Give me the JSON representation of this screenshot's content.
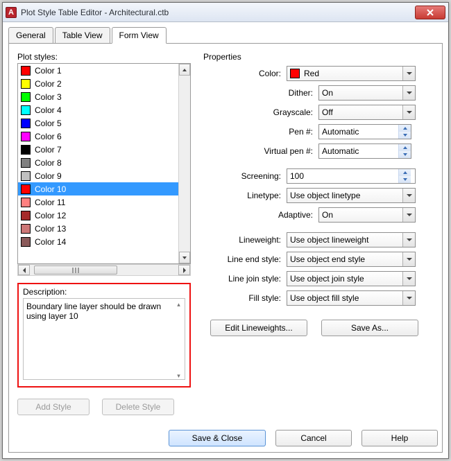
{
  "window": {
    "title": "Plot Style Table Editor - Architectural.ctb",
    "app_icon_letter": "A"
  },
  "tabs": {
    "general": "General",
    "table_view": "Table View",
    "form_view": "Form View"
  },
  "left": {
    "plot_styles_label": "Plot styles:",
    "items": [
      {
        "label": "Color 1",
        "swatch": "#ff0000"
      },
      {
        "label": "Color 2",
        "swatch": "#ffff00"
      },
      {
        "label": "Color 3",
        "swatch": "#00ff00"
      },
      {
        "label": "Color 4",
        "swatch": "#00ffff"
      },
      {
        "label": "Color 5",
        "swatch": "#0000ff"
      },
      {
        "label": "Color 6",
        "swatch": "#ff00ff"
      },
      {
        "label": "Color 7",
        "swatch": "#000000"
      },
      {
        "label": "Color 8",
        "swatch": "#808080"
      },
      {
        "label": "Color 9",
        "swatch": "#c0c0c0"
      },
      {
        "label": "Color 10",
        "swatch": "#ff0000"
      },
      {
        "label": "Color 11",
        "swatch": "#ff8080"
      },
      {
        "label": "Color 12",
        "swatch": "#a52a2a"
      },
      {
        "label": "Color 13",
        "swatch": "#cd7777"
      },
      {
        "label": "Color 14",
        "swatch": "#8b5a5a"
      }
    ],
    "selected_index": 9,
    "description_label": "Description:",
    "description_text": "Boundary line layer should be drawn using layer 10",
    "add_style": "Add Style",
    "delete_style": "Delete Style"
  },
  "right": {
    "group_label": "Properties",
    "color_label": "Color:",
    "color_value": "Red",
    "color_swatch": "#ff0000",
    "dither_label": "Dither:",
    "dither_value": "On",
    "grayscale_label": "Grayscale:",
    "grayscale_value": "Off",
    "pen_label": "Pen #:",
    "pen_value": "Automatic",
    "virtual_pen_label": "Virtual pen #:",
    "virtual_pen_value": "Automatic",
    "screening_label": "Screening:",
    "screening_value": "100",
    "linetype_label": "Linetype:",
    "linetype_value": "Use object linetype",
    "adaptive_label": "Adaptive:",
    "adaptive_value": "On",
    "lineweight_label": "Lineweight:",
    "lineweight_value": "Use object lineweight",
    "line_end_label": "Line end style:",
    "line_end_value": "Use object end style",
    "line_join_label": "Line join style:",
    "line_join_value": "Use object join style",
    "fill_style_label": "Fill style:",
    "fill_style_value": "Use object fill style",
    "edit_lineweights": "Edit Lineweights...",
    "save_as": "Save As..."
  },
  "footer": {
    "save_close": "Save & Close",
    "cancel": "Cancel",
    "help": "Help"
  }
}
